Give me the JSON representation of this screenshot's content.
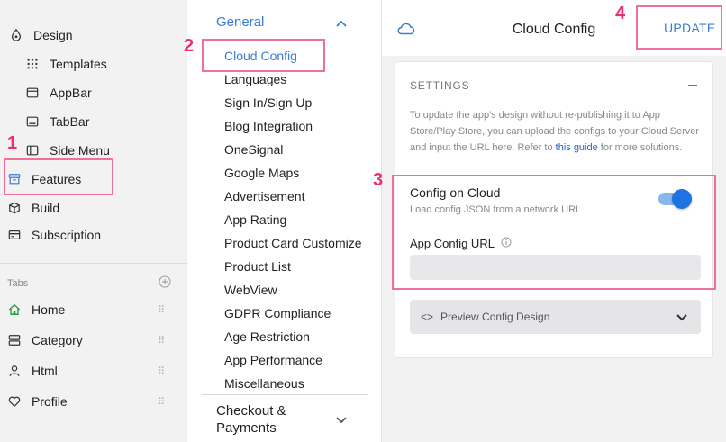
{
  "sidebar": {
    "top_items": [
      {
        "label": "Design",
        "icon": "design-icon"
      },
      {
        "label": "Templates",
        "icon": "grid-icon"
      },
      {
        "label": "AppBar",
        "icon": "appbar-icon"
      },
      {
        "label": "TabBar",
        "icon": "tabbar-icon"
      },
      {
        "label": "Side Menu",
        "icon": "side-menu-icon"
      },
      {
        "label": "Features",
        "icon": "features-icon"
      },
      {
        "label": "Build",
        "icon": "cube-icon"
      },
      {
        "label": "Subscription",
        "icon": "card-icon"
      }
    ],
    "tabs_label": "Tabs",
    "tab_items": [
      {
        "label": "Home",
        "icon": "home-icon"
      },
      {
        "label": "Category",
        "icon": "category-icon"
      },
      {
        "label": "Html",
        "icon": "person-icon"
      },
      {
        "label": "Profile",
        "icon": "heart-icon"
      }
    ]
  },
  "config_list": {
    "group_title": "General",
    "items": [
      "Cloud Config",
      "Languages",
      "Sign In/Sign Up",
      "Blog Integration",
      "OneSignal",
      "Google Maps",
      "Advertisement",
      "App Rating",
      "Product Card Customize",
      "Product List",
      "WebView",
      "GDPR Compliance",
      "Age Restriction",
      "App Performance",
      "Miscellaneous"
    ],
    "next_group_line1": "Checkout &",
    "next_group_line2": "Payments"
  },
  "panel": {
    "title": "Cloud Config",
    "update_label": "UPDATE",
    "settings_label": "SETTINGS",
    "description_before": "To update the app's design without re-publishing it to App Store/Play Store, you can upload the configs to your Cloud Server and input the URL here. Refer to ",
    "description_link": "this guide",
    "description_after": " for more solutions.",
    "config_on_cloud_label": "Config on Cloud",
    "config_on_cloud_sublabel": "Load config JSON from a network URL",
    "config_on_cloud_enabled": true,
    "app_config_url_label": "App Config URL",
    "app_config_url_value": "",
    "preview_label": "Preview Config Design"
  },
  "annotations": [
    "1",
    "2",
    "3",
    "4"
  ],
  "colors": {
    "accent": "#3a7bd5",
    "highlight": "#f0709a",
    "annotation_number": "#ec2d72",
    "toggle": "#1e72e2"
  }
}
